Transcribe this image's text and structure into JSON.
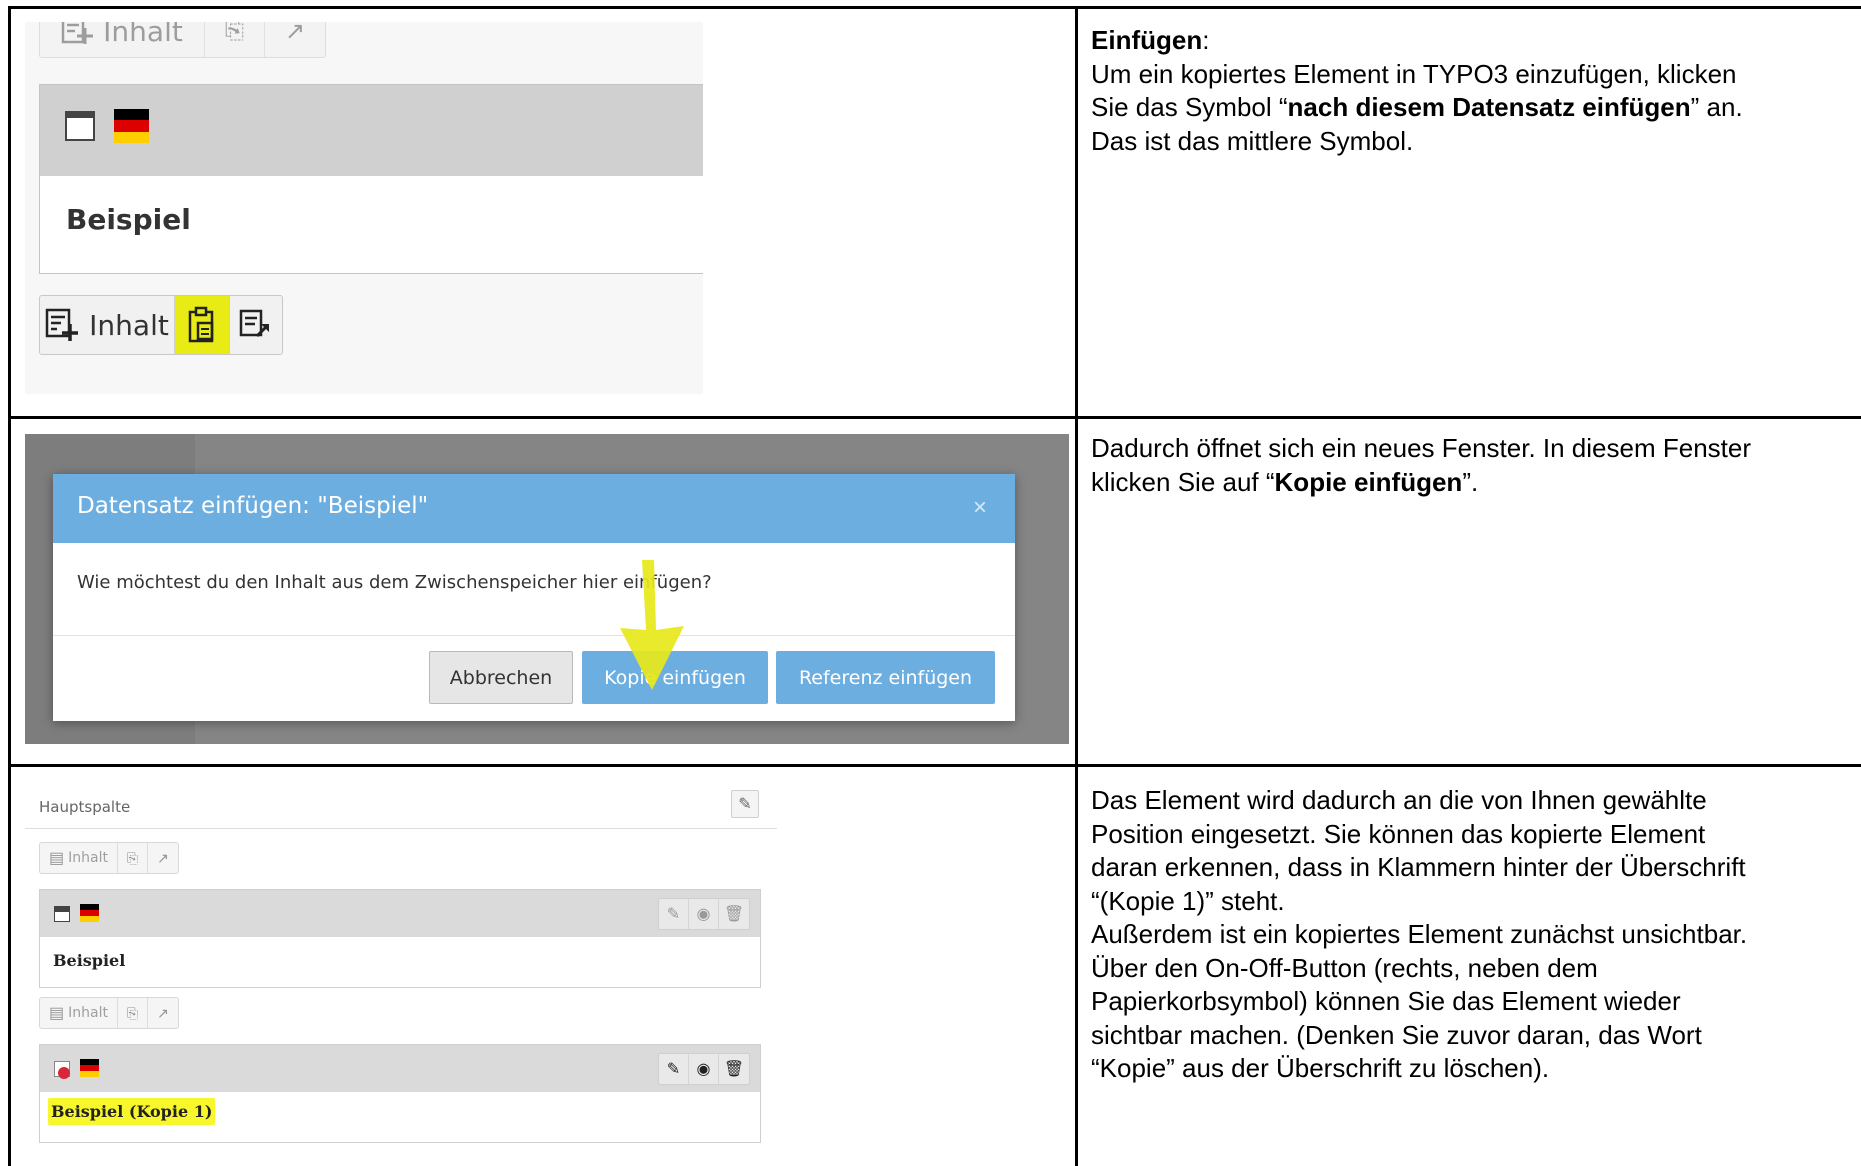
{
  "rows": [
    {
      "text_html_parts": {
        "heading": "Einfügen",
        "heading_suffix": ":",
        "line1_a": "Um ein kopiertes Element in TYPO3 einzufügen, klicken",
        "line2_a": "Sie das Symbol “",
        "line2_bold": "nach diesem Datensatz einfügen",
        "line2_b": "” an.",
        "line3": "Das ist das mittlere Symbol."
      },
      "shot": {
        "toolbar_label": "Inhalt",
        "element_title": "Beispiel"
      }
    },
    {
      "text_html_parts": {
        "line1": "Dadurch öffnet sich ein neues Fenster. In diesem Fenster",
        "line2_a": "klicken Sie auf “",
        "line2_bold": "Kopie einfügen",
        "line2_b": "”."
      },
      "shot": {
        "dialog_title": "Datensatz einfügen: \"Beispiel\"",
        "close_symbol": "×",
        "dialog_question": "Wie möchtest du den Inhalt aus dem Zwischenspeicher hier einfügen?",
        "btn_cancel": "Abbrechen",
        "btn_copy": "Kopie einfügen",
        "btn_reference": "Referenz einfügen"
      }
    },
    {
      "text_lines": [
        "Das Element wird dadurch an die von Ihnen gewählte",
        "Position eingesetzt. Sie können das kopierte Element",
        "daran erkennen, dass in Klammern hinter der Überschrift",
        "“(Kopie 1)” steht.",
        "Außerdem ist ein kopiertes Element zunächst unsichtbar.",
        "Über den On-Off-Button (rechts, neben dem",
        "Papierkorbsymbol) können Sie das Element wieder",
        "sichtbar machen. (Denken Sie zuvor daran, das Wort",
        "“Kopie” aus der Überschrift zu löschen)."
      ],
      "shot": {
        "column_title": "Hauptspalte",
        "toolbar_label": "Inhalt",
        "element1_title": "Beispiel",
        "element2_title": "Beispiel (Kopie 1)"
      }
    }
  ],
  "colors": {
    "highlight": "#f7f72b",
    "dialog_blue": "#6daee1",
    "arrow": "#e8e81a",
    "flag_black": "#000000",
    "flag_red": "#dd0000",
    "flag_gold": "#ffce00"
  },
  "icons": [
    "add-content-icon",
    "paste-icon",
    "paste-reference-icon",
    "window-icon",
    "german-flag-icon",
    "edit-pencil-icon",
    "toggle-visibility-icon",
    "trash-icon",
    "hidden-badge-icon",
    "close-icon",
    "down-arrow-annotation"
  ]
}
